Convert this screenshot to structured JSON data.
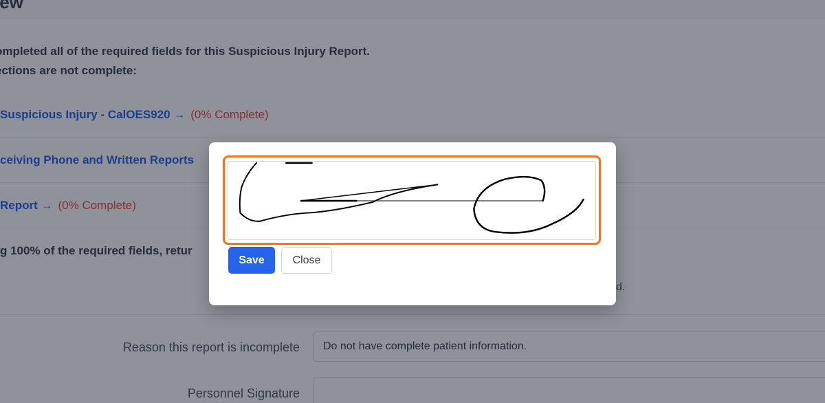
{
  "page": {
    "heading": "iew",
    "intro_line_1": "ompleted all of the required fields for this Suspicious Injury Report.",
    "intro_line_2": "ections are not complete:",
    "sections": [
      {
        "label": "Suspicious Injury - CalOES920 →",
        "status": "(0% Complete)"
      },
      {
        "label": "ceiving Phone and Written Reports",
        "status": ""
      },
      {
        "label": " Report →",
        "status": "(0% Complete)"
      }
    ],
    "instruction": "g 100% of the required fields, retur",
    "trailing_fragment": "d.",
    "fields": {
      "reason_label": "Reason this report is incomplete",
      "reason_value": "Do not have complete patient information.",
      "signature_label": "Personnel Signature"
    }
  },
  "modal": {
    "save_label": "Save",
    "close_label": "Close"
  }
}
